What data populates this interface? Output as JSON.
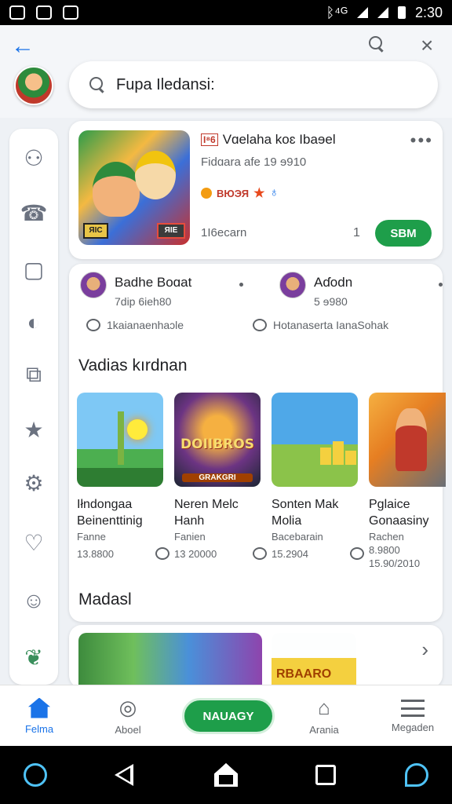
{
  "status_bar": {
    "time": "2:30",
    "network": "ᛒ⁴ᴳ"
  },
  "header": {
    "search_placeholder": "Fupa Iledansi:"
  },
  "sidebar": {
    "items": [
      {
        "icon": "person-badge-icon"
      },
      {
        "icon": "add-contact-icon"
      },
      {
        "icon": "folder-icon"
      },
      {
        "icon": "globe-icon"
      },
      {
        "icon": "share-box-icon"
      },
      {
        "icon": "star-icon"
      },
      {
        "icon": "settings-icon"
      },
      {
        "icon": "heart-icon"
      },
      {
        "icon": "smiley-icon"
      },
      {
        "icon": "leaf-icon"
      }
    ]
  },
  "featured": {
    "tag": "I⁸6",
    "title": "Vɑelaha koɛ Ibaɘel",
    "subtitle": "Fidɑara afe 19 ɘ910",
    "rating_text": "BЮЭЯ",
    "meta": "1I6ecarn",
    "count": "1",
    "action_label": "SBM",
    "art_badge_left": "ЯIC",
    "art_badge_right": "ЯIE"
  },
  "friends": [
    {
      "name": "Badhe Boɑat",
      "sub": "7dip 6ieh80",
      "comment": "1kaianaenhaɔle"
    },
    {
      "name": "Aɗodn",
      "sub": "5 ɘ980",
      "comment": "Hotanaserta IanaSohak"
    }
  ],
  "sections": {
    "recommended_title": "Vadias kırdnan",
    "madasl_title": "Madasl"
  },
  "games": [
    {
      "name": "Iłndongaa Beinenttinig",
      "category": "Fanne",
      "value": "13.8800"
    },
    {
      "name": "Neren Melc Hanh",
      "category": "Fanien",
      "value": "13 20000"
    },
    {
      "name": "Sonten Mak Molia",
      "category": "Bacebarain",
      "value": "15.2904"
    },
    {
      "name": "Pglaice Gonaasiny",
      "category": "Rachen",
      "value": "8.9800",
      "value2": "15.90/2010"
    }
  ],
  "game_art": {
    "art2_logo": "DOIIBROS",
    "art2_sub": "GRAKGRI"
  },
  "madasl": {
    "art2_text": "RBAARO"
  },
  "bottom_nav": {
    "home": "Fеlma",
    "aboel": "Aboel",
    "cta": "NAUAGY",
    "arena": "Arania",
    "menu": "Megaden"
  },
  "colors": {
    "accent": "#1a73e8",
    "cta_green": "#1e9e4a"
  }
}
